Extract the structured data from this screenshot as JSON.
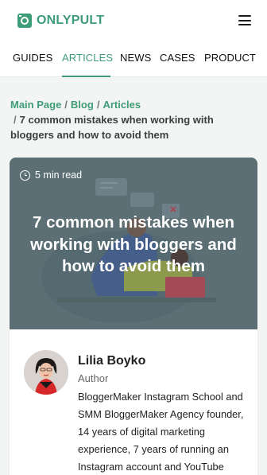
{
  "header": {
    "logo_text": "ONLYPULT"
  },
  "nav": {
    "items": [
      {
        "label": "GUIDES"
      },
      {
        "label": "ARTICLES"
      },
      {
        "label": "NEWS"
      },
      {
        "label": "CASES"
      },
      {
        "label": "PRODUCT"
      }
    ],
    "active": "ARTICLES"
  },
  "breadcrumb": {
    "items": [
      {
        "label": "Main Page"
      },
      {
        "label": "Blog"
      },
      {
        "label": "Articles"
      }
    ],
    "separator": "/",
    "current": "7 common mistakes when working with bloggers and how to avoid them"
  },
  "article": {
    "read_time": "5 min read",
    "title": "7 common mistakes when working with bloggers and how to avoid them"
  },
  "author": {
    "name": "Lilia Boyko",
    "role": "Author",
    "bio": "BloggerMaker Instagram School and SMM BloggerMaker Agency founder, 14 years of digital marketing experience, 7 years of running an Instagram account and YouTube"
  },
  "colors": {
    "brand": "#3f9c78",
    "hero_overlay": "#5c6f75"
  }
}
